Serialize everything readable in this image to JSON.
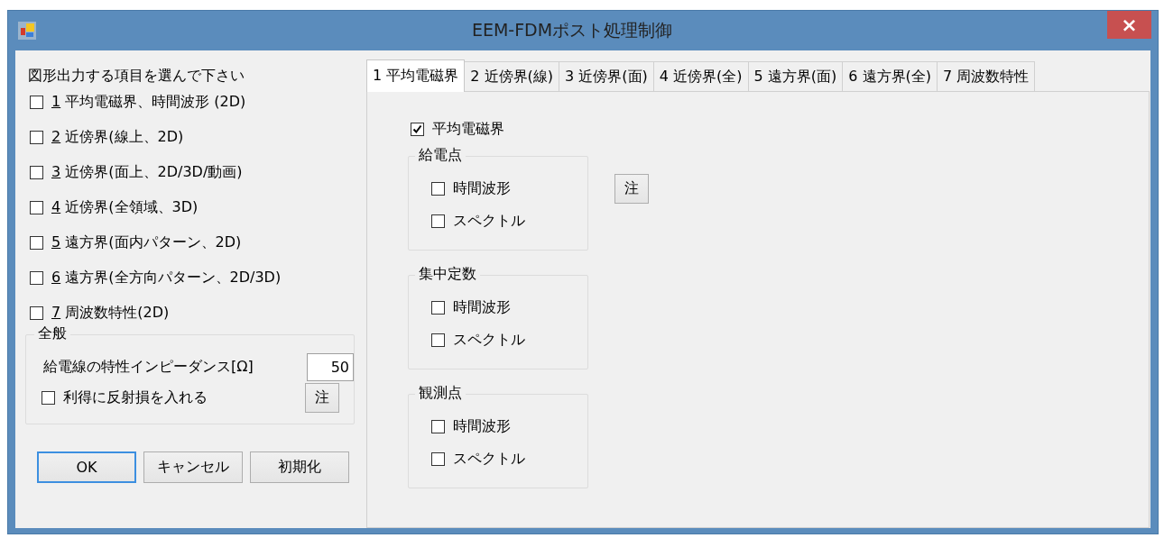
{
  "window": {
    "title": "EEM-FDMポスト処理制御",
    "close": "×"
  },
  "left": {
    "prompt": "図形出力する項目を選んで下さい",
    "items": [
      {
        "key": "1",
        "text": "平均電磁界、時間波形 (2D)",
        "checked": false
      },
      {
        "key": "2",
        "text": "近傍界(線上、2D)",
        "checked": false
      },
      {
        "key": "3",
        "text": "近傍界(面上、2D/3D/動画)",
        "checked": false
      },
      {
        "key": "4",
        "text": "近傍界(全領域、3D)",
        "checked": false
      },
      {
        "key": "5",
        "text": "遠方界(面内パターン、2D)",
        "checked": false
      },
      {
        "key": "6",
        "text": "遠方界(全方向パターン、2D/3D)",
        "checked": false
      },
      {
        "key": "7",
        "text": "周波数特性(2D)",
        "checked": false
      }
    ],
    "general": {
      "title": "全般",
      "impedance_label": "給電線の特性インピーダンス[Ω]",
      "impedance_value": "50",
      "gain_option": {
        "label": "利得に反射損を入れる",
        "checked": false
      },
      "note_button": "注"
    },
    "buttons": [
      {
        "label": "OK",
        "default": true
      },
      {
        "label": "キャンセル",
        "default": false
      },
      {
        "label": "初期化",
        "default": false
      }
    ]
  },
  "tabs": [
    {
      "label": "1 平均電磁界",
      "selected": true
    },
    {
      "label": "2 近傍界(線)",
      "selected": false
    },
    {
      "label": "3 近傍界(面)",
      "selected": false
    },
    {
      "label": "4 近傍界(全)",
      "selected": false
    },
    {
      "label": "5 遠方界(面)",
      "selected": false
    },
    {
      "label": "6 遠方界(全)",
      "selected": false
    },
    {
      "label": "7 周波数特性",
      "selected": false
    }
  ],
  "tab_page": {
    "main_option": {
      "label": "平均電磁界",
      "checked": true
    },
    "note_button": "注",
    "groups": [
      {
        "title": "給電点",
        "options": [
          {
            "label": "時間波形",
            "checked": false
          },
          {
            "label": "スペクトル",
            "checked": false
          }
        ]
      },
      {
        "title": "集中定数",
        "options": [
          {
            "label": "時間波形",
            "checked": false
          },
          {
            "label": "スペクトル",
            "checked": false
          }
        ]
      },
      {
        "title": "観測点",
        "options": [
          {
            "label": "時間波形",
            "checked": false
          },
          {
            "label": "スペクトル",
            "checked": false
          }
        ]
      }
    ]
  }
}
